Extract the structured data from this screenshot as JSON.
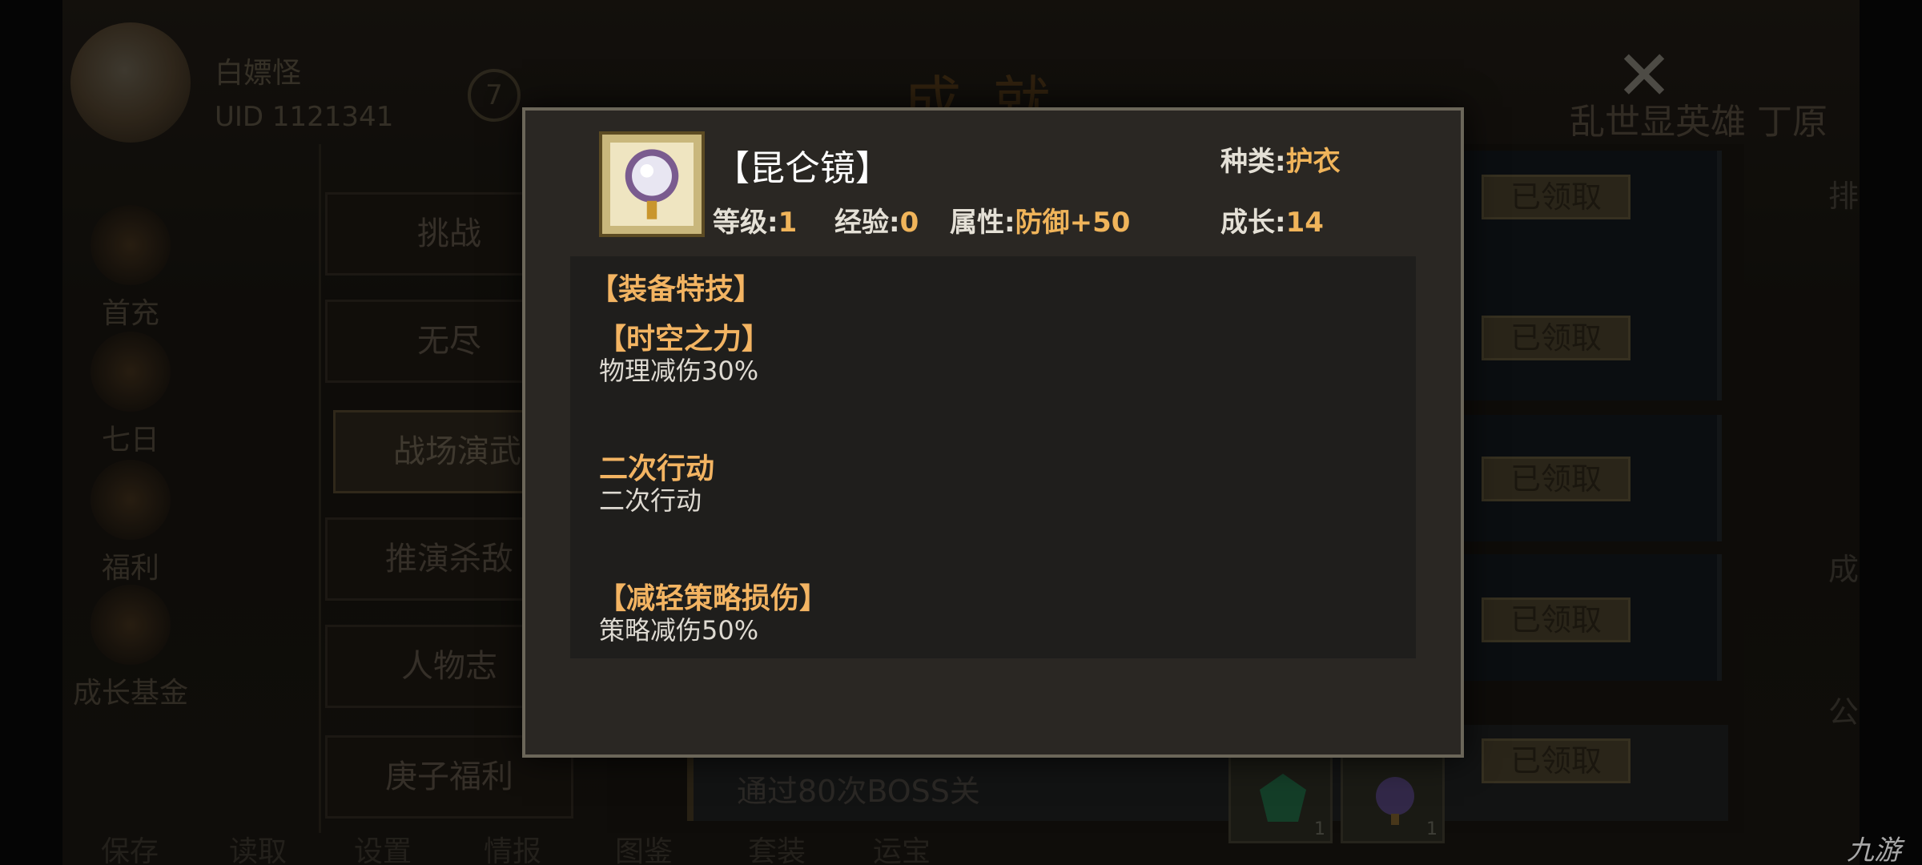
{
  "header": {
    "player_name": "白嫖怪",
    "uid": "UID  1121341",
    "level": "7",
    "page_title": "成就",
    "banner": "乱世显英雄 丁原府"
  },
  "left_menu": [
    "首充",
    "七日",
    "福利",
    "成长基金",
    "保存"
  ],
  "tabs": [
    {
      "label": "挑战"
    },
    {
      "label": "无尽"
    },
    {
      "label": "战场演武"
    },
    {
      "label": "推演杀敌"
    },
    {
      "label": "人物志"
    },
    {
      "label": "庚子福利"
    }
  ],
  "list": {
    "claim_label": "已领取",
    "last_row_desc": "通过80次BOSS关",
    "reward_counts": [
      "1",
      "1"
    ]
  },
  "right_menu": [
    "排行",
    "成就",
    "公告"
  ],
  "bottom_bar": [
    "读取",
    "设置",
    "情报",
    "图鉴",
    "套装",
    "运宝"
  ],
  "watermark": "九游",
  "modal": {
    "item_name": "【昆仑镜】",
    "type_label": "种类:",
    "type_value": "护衣",
    "level_label": "等级:",
    "level_value": "1",
    "exp_label": "经验:",
    "exp_value": "0",
    "attr_label": "属性:",
    "attr_value": "防御+50",
    "growth_label": "成长:",
    "growth_value": "14",
    "skills_title": "【装备特技】",
    "skills": [
      {
        "name": "【时空之力】",
        "desc": "物理减伤30%"
      },
      {
        "name": "二次行动",
        "desc": "二次行动"
      },
      {
        "name": "【减轻策略损伤】",
        "desc": "策略减伤50%"
      }
    ]
  },
  "colors": {
    "accent": "#f0b45a",
    "modal_bg": "#2a2723",
    "panel_bg": "#1f1e1c"
  }
}
